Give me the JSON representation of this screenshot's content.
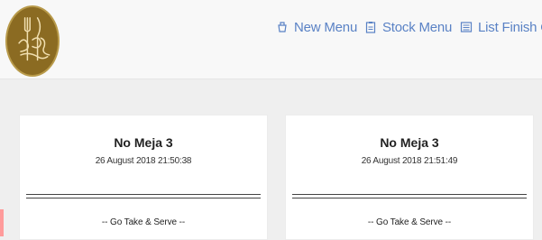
{
  "brand": {
    "logo_icon": "eat-chef-logo-icon",
    "logo_color": "#8b6b22"
  },
  "nav": {
    "items": [
      {
        "label": "New Menu",
        "icon": "cup-icon"
      },
      {
        "label": "Stock Menu",
        "icon": "clipboard-icon"
      },
      {
        "label": "List Finish O",
        "icon": "list-icon"
      }
    ],
    "link_color": "#5a82c5"
  },
  "orders": [
    {
      "table": "No Meja 3",
      "datetime": "26 August 2018 21:50:38",
      "status": "-- Go Take & Serve --"
    },
    {
      "table": "No Meja 3",
      "datetime": "26 August 2018 21:51:49",
      "status": "-- Go Take & Serve --"
    }
  ]
}
